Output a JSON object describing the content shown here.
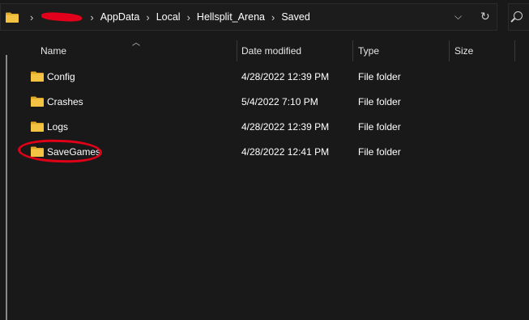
{
  "address_bar": {
    "breadcrumbs": [
      "AppData",
      "Local",
      "Hellsplit_Arena",
      "Saved"
    ]
  },
  "columns": {
    "name": "Name",
    "date_modified": "Date modified",
    "type": "Type",
    "size": "Size"
  },
  "files": [
    {
      "name": "Config",
      "date": "4/28/2022 12:39 PM",
      "type": "File folder"
    },
    {
      "name": "Crashes",
      "date": "5/4/2022 7:10 PM",
      "type": "File folder"
    },
    {
      "name": "Logs",
      "date": "4/28/2022 12:39 PM",
      "type": "File folder"
    },
    {
      "name": "SaveGames",
      "date": "4/28/2022 12:41 PM",
      "type": "File folder"
    }
  ],
  "icons": {
    "folder": "folder-icon",
    "chevron": "chevron-right-icon",
    "dropdown": "chevron-down-icon",
    "refresh": "refresh-icon",
    "search": "search-icon"
  },
  "colors": {
    "background": "#191919",
    "folder_yellow": "#f5c343",
    "annotation_red": "#e00018",
    "redaction_red": "#e3001b"
  }
}
